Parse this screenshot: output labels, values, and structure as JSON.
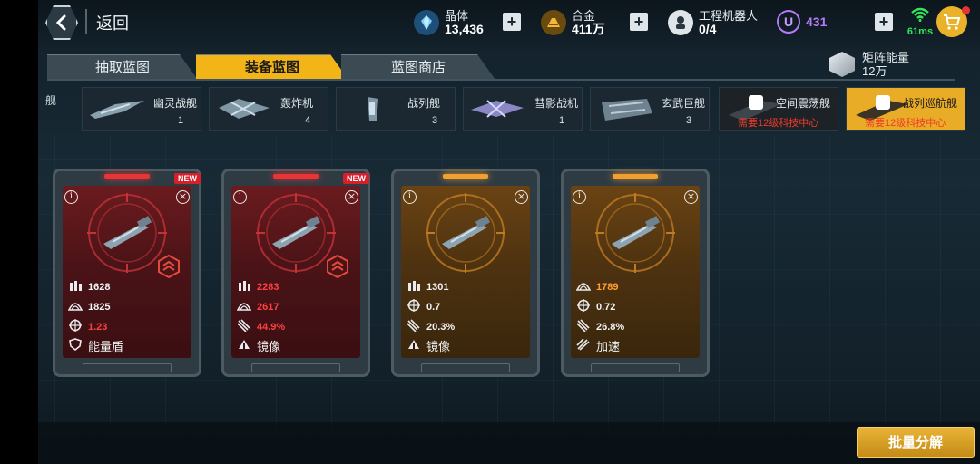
{
  "header": {
    "back_label": "返回",
    "resources": [
      {
        "name": "晶体",
        "value": "13,436",
        "icon": "crystal-icon",
        "color": "#4aa8e8"
      },
      {
        "name": "合金",
        "value": "411万",
        "icon": "alloy-icon",
        "color": "#e8a31c"
      },
      {
        "name": "工程机器人",
        "value": "0/4",
        "icon": "robot-icon",
        "color": "#dfe5e8"
      }
    ],
    "premium": {
      "letter": "U",
      "value": "431",
      "color": "#b47cf7"
    },
    "network": {
      "latency": "61ms",
      "color": "#35e35a"
    }
  },
  "tabs": [
    {
      "label": "抽取蓝图",
      "active": false
    },
    {
      "label": "装备蓝图",
      "active": true
    },
    {
      "label": "蓝图商店",
      "active": false
    }
  ],
  "matrix_energy": {
    "label": "矩阵能量",
    "value": "12万"
  },
  "ship_edge_label": "舰",
  "ships": [
    {
      "name": "幽灵战舰",
      "count": "1",
      "locked": false
    },
    {
      "name": "轰炸机",
      "count": "4",
      "locked": false
    },
    {
      "name": "战列舰",
      "count": "3",
      "locked": false
    },
    {
      "name": "彗影战机",
      "count": "1",
      "locked": false
    },
    {
      "name": "玄武巨舰",
      "count": "3",
      "locked": false
    },
    {
      "name": "空间震荡舰",
      "requirement": "需要12级科技中心",
      "locked": true,
      "active": false
    },
    {
      "name": "战列巡航舰",
      "requirement": "需要12级科技中心",
      "locked": true,
      "active": true
    }
  ],
  "cards": [
    {
      "rarity": "red",
      "new": "NEW",
      "has_rank": true,
      "stats": [
        {
          "icon": "ammo-icon",
          "value": "1628"
        },
        {
          "icon": "armor-icon",
          "value": "1825"
        },
        {
          "icon": "crosshair-icon",
          "value": "1.23",
          "highlight": "red"
        }
      ],
      "skill": {
        "icon": "shield-icon",
        "label": "能量盾"
      }
    },
    {
      "rarity": "red",
      "new": "NEW",
      "has_rank": true,
      "stats": [
        {
          "icon": "ammo-icon",
          "value": "2283",
          "highlight": "red"
        },
        {
          "icon": "armor-icon",
          "value": "2617",
          "highlight": "red"
        },
        {
          "icon": "missile-icon",
          "value": "44.9%",
          "highlight": "red"
        }
      ],
      "skill": {
        "icon": "mirror-icon",
        "label": "镜像"
      }
    },
    {
      "rarity": "gold",
      "new": "",
      "has_rank": false,
      "stats": [
        {
          "icon": "ammo-icon",
          "value": "1301"
        },
        {
          "icon": "crosshair-icon",
          "value": "0.7"
        },
        {
          "icon": "missile-icon",
          "value": "20.3%"
        }
      ],
      "skill": {
        "icon": "mirror-icon",
        "label": "镜像"
      }
    },
    {
      "rarity": "gold",
      "new": "",
      "has_rank": false,
      "stats": [
        {
          "icon": "armor-icon",
          "value": "1789",
          "highlight": "orange"
        },
        {
          "icon": "crosshair-icon",
          "value": "0.72"
        },
        {
          "icon": "missile-icon",
          "value": "26.8%"
        }
      ],
      "skill": {
        "icon": "speed-icon",
        "label": "加速"
      }
    }
  ],
  "actions": {
    "decompose_label": "批量分解"
  }
}
